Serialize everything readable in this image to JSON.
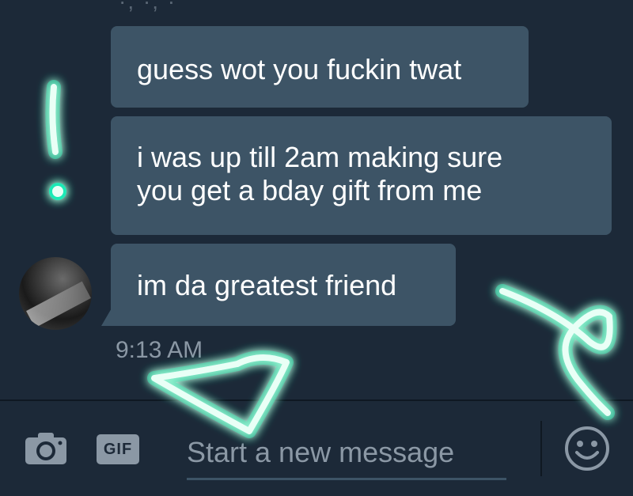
{
  "messages": [
    {
      "lines": [
        "guess wot you fuckin twat"
      ]
    },
    {
      "lines": [
        "i was up till 2am making sure",
        "you get a bday gift from me"
      ]
    },
    {
      "lines": [
        "im da greatest friend"
      ]
    }
  ],
  "timestamp": "9:13 AM",
  "composer": {
    "placeholder": "Start a new message",
    "gif_label": "GIF"
  },
  "icons": {
    "camera": "camera-icon",
    "gif": "gif-icon",
    "emoji": "smiley-icon"
  },
  "colors": {
    "background": "#1c2938",
    "bubble": "#3d5466",
    "muted_text": "#8b98a5",
    "doodle": "#e9fff6",
    "doodle_glow": "#1de9b6"
  }
}
